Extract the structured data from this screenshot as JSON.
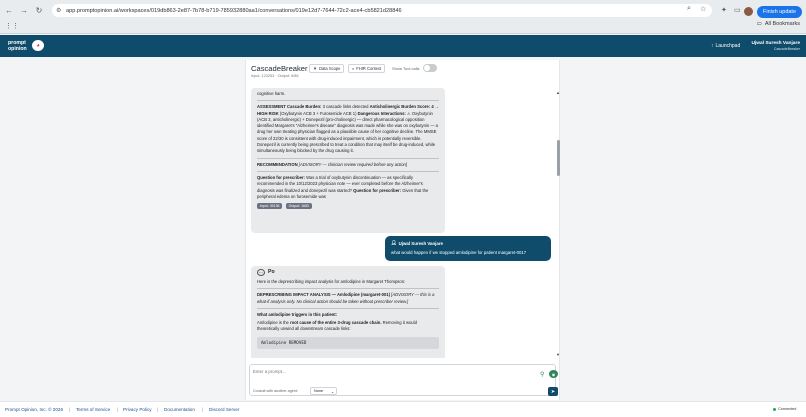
{
  "browser": {
    "url": "app.promptopinion.ai/workspaces/019db863-2e87-7b78-b719-785932880aa1/conversations/019e12d7-7644-72c2-ace4-cb5821d28846",
    "update_label": "Finish update",
    "all_bookmarks": "All Bookmarks"
  },
  "header": {
    "logo_line1": "prompt",
    "logo_line2": "opinion",
    "launchpad": "Launchpad",
    "user_name": "Ujwal Suresh Vanjare",
    "user_sub": "CascadeBreaker"
  },
  "conversation": {
    "title": "CascadeBreaker",
    "tokens": "Input: 123253 · Output: 6/86",
    "data_scope": "Data Scope",
    "fhir_context": "FHIR Context",
    "show_tool_calls": "Show Tool calls"
  },
  "msg1": {
    "top_line": "cognitive harm.",
    "assess_label": "ASSESSMENT Cascade Burden:",
    "assess_1": " 3 cascade links detected ",
    "assess_bold": "Anticholinergic Burden Score: 4 → HIGH RISK",
    "assess_2": " (Oxybutynin ACB 3 + Furosemide ACB 1) ",
    "assess_bold2": "Dangerous Interactions:",
    "assess_3": " ⚠ Oxybutynin (ACB 3, anticholinergic) + Donepezil (pro-cholinergic) — direct pharmacological opposition identified Margaret's \"Alzheimer's disease\" diagnosis was made while she was on oxybutynin — a drug her own treating physician flagged as a plausible cause of her cognitive decline. The MMSE score of 22/30 is consistent with drug-induced impairment, which is potentially reversible. Donepezil is currently being prescribed to treat a condition that may itself be drug-induced, while simultaneously being blocked by the drug causing it.",
    "rec_label": "RECOMMENDATION",
    "rec_text": " [ADVISORY — clinician review required before any action]",
    "q_label": "Question for prescriber:",
    "q_text": " Was a trial of oxybutynin discontinuation — as specifically recommended in the 10/12/2023 physician note — ever completed before the Alzheimer's diagnosis was finalized and donepezil was started? ",
    "q_label2": "Question for prescriber:",
    "q_text2": " Given that the peripheral edema on furosemide was",
    "chip_input": "Input: 39136",
    "chip_output": "Output: 1683"
  },
  "msg_user": {
    "name": "Ujwal Suresh Vanjare",
    "text": "what would happen if we stopped amlodipine for patient margaret-0017"
  },
  "msg2": {
    "sender": "Po",
    "intro": "Here is the deprescribing impact analysis for amlodipine in Margaret Thompson:",
    "analysis_label": "DEPRESCRIBING IMPACT ANALYSIS — Amlodipine (margaret-001)",
    "analysis_note": " [ADVISORY — this is a what-if analysis only. No clinical action should be taken without prescriber review.]",
    "triggers_heading": "What amlodipine triggers in this patient:",
    "root_1": "Amlodipine is the ",
    "root_bold": "root cause of the entire 3-drug cascade chain.",
    "root_2": " Removing it would theoretically unwind all downstream cascade links:",
    "code": "Amlodipine REMOVED"
  },
  "composer": {
    "placeholder": "Enter a prompt...",
    "consult_label": "Consult with another agent:",
    "agent_selected": "None"
  },
  "footer": {
    "copyright": "Prompt Opinion, Inc. © 2026",
    "terms": "Terms of Service",
    "privacy": "Privacy Policy",
    "docs": "Documentation",
    "discord": "Discord Server",
    "status": "Connected"
  }
}
